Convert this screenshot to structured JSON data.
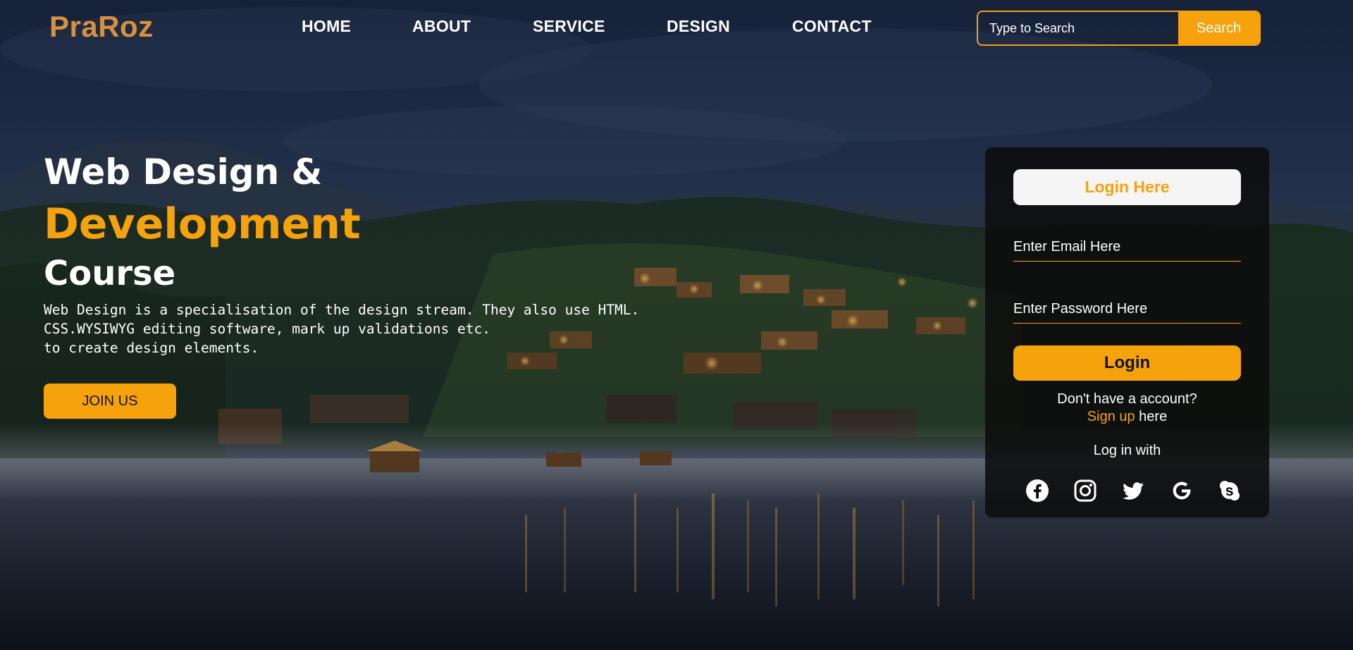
{
  "brand": {
    "logo": "PraRoz"
  },
  "nav": {
    "items": [
      {
        "label": "HOME"
      },
      {
        "label": "ABOUT"
      },
      {
        "label": "SERVICE"
      },
      {
        "label": "DESIGN"
      },
      {
        "label": "CONTACT"
      }
    ]
  },
  "search": {
    "placeholder": "Type to Search",
    "button_label": "Search"
  },
  "hero": {
    "title_line1": "Web Design &",
    "title_line2": "Development",
    "title_line3": "Course",
    "description": "Web Design is a specialisation of the design stream. They also use HTML.\nCSS.WYSIWYG editing software, mark up validations etc.\nto create design elements.",
    "cta_label": "JOIN US"
  },
  "login": {
    "title": "Login Here",
    "email_placeholder": "Enter Email Here",
    "password_placeholder": "Enter Password Here",
    "button_label": "Login",
    "no_account_text": "Don't have a account?",
    "signup_link": "Sign up",
    "signup_suffix": " here",
    "login_with_text": "Log in with",
    "socials": [
      "facebook-icon",
      "instagram-icon",
      "twitter-icon",
      "google-icon",
      "skype-icon"
    ]
  },
  "colors": {
    "accent": "#f5a20d",
    "logo": "#d98f3f",
    "card_bg": "#0c0c0c",
    "title_bg": "#f5f5f5"
  }
}
